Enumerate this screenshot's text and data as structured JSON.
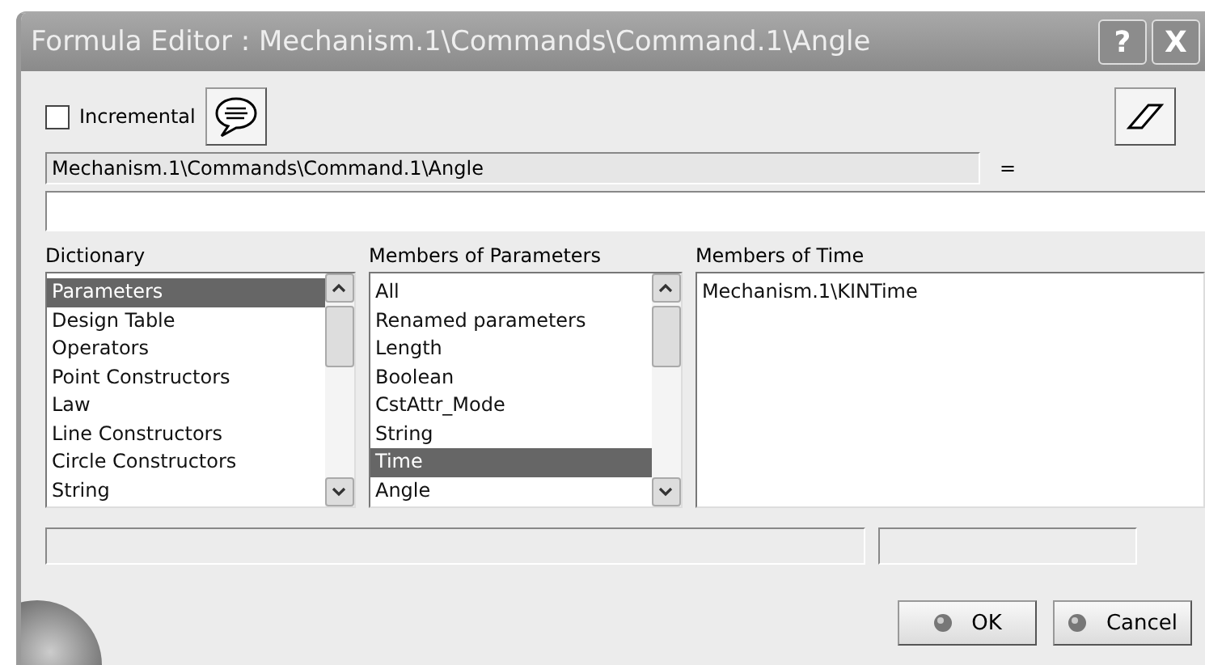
{
  "window": {
    "title": "Formula Editor : Mechanism.1\\Commands\\Command.1\\Angle",
    "title_buttons": [
      "?",
      "X"
    ]
  },
  "incremental": {
    "label": "Incremental",
    "checked": false
  },
  "formula_name": {
    "value": "Mechanism.1\\Commands\\Command.1\\Angle",
    "equals": "="
  },
  "lists": [
    {
      "title": "Dictionary",
      "scroll": true,
      "items": [
        {
          "label": "Parameters",
          "selected": true
        },
        {
          "label": "Design Table",
          "selected": false
        },
        {
          "label": "Operators",
          "selected": false
        },
        {
          "label": "Point Constructors",
          "selected": false
        },
        {
          "label": "Law",
          "selected": false
        },
        {
          "label": "Line Constructors",
          "selected": false
        },
        {
          "label": "Circle Constructors",
          "selected": false
        },
        {
          "label": "String",
          "selected": false
        }
      ]
    },
    {
      "title": "Members of Parameters",
      "scroll": true,
      "items": [
        {
          "label": "All",
          "selected": false
        },
        {
          "label": "Renamed parameters",
          "selected": false
        },
        {
          "label": "Length",
          "selected": false
        },
        {
          "label": "Boolean",
          "selected": false
        },
        {
          "label": "CstAttr_Mode",
          "selected": false
        },
        {
          "label": "String",
          "selected": false
        },
        {
          "label": "Time",
          "selected": true
        },
        {
          "label": "Angle",
          "selected": false
        }
      ]
    },
    {
      "title": "Members of Time",
      "scroll": false,
      "items": [
        {
          "label": "Mechanism.1\\KINTime",
          "selected": false
        }
      ]
    }
  ],
  "buttons": [
    "OK",
    "Cancel"
  ]
}
